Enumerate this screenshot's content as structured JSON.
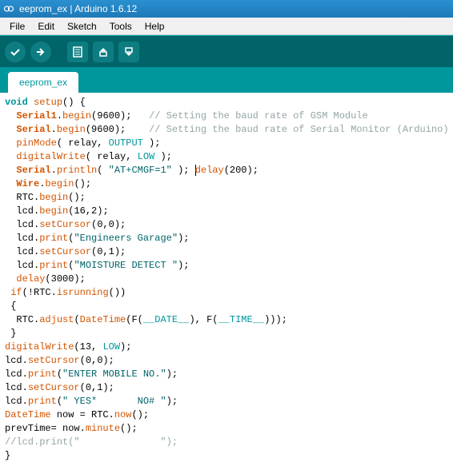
{
  "window": {
    "title": "eeprom_ex | Arduino 1.6.12"
  },
  "menu": {
    "items": [
      "File",
      "Edit",
      "Sketch",
      "Tools",
      "Help"
    ]
  },
  "tab": {
    "label": "eeprom_ex"
  },
  "code": {
    "l1_void": "void",
    "l1_setup": "setup",
    "l1_rest": "() {",
    "l2_obj": "Serial1",
    "l2_dot": ".",
    "l2_fn": "begin",
    "l2_args": "(9600);   ",
    "l2_cmt": "// Setting the baud rate of GSM Module",
    "l3_obj": "Serial",
    "l3_fn": "begin",
    "l3_args": "(9600);    ",
    "l3_cmt": "// Setting the baud rate of Serial Monitor (Arduino)",
    "l4_fn": "pinMode",
    "l4_args": "( relay, ",
    "l4_const": "OUTPUT",
    "l4_end": " );",
    "l5_fn": "digitalWrite",
    "l5_args": "( relay, ",
    "l5_const": "LOW",
    "l5_end": " );",
    "l6_obj": "Serial",
    "l6_fn": "println",
    "l6_open": "( ",
    "l6_str": "\"AT+CMGF=1\"",
    "l6_mid": " ); ",
    "l6_fn2": "delay",
    "l6_end": "(200);",
    "l7_obj": "Wire",
    "l7_fn": "begin",
    "l7_end": "();",
    "l8_obj": "RTC",
    "l8_fn": "begin",
    "l8_end": "();",
    "l9_obj": "lcd",
    "l9_fn": "begin",
    "l9_end": "(16,2);",
    "l10_fn": "setCursor",
    "l10_end": "(0,0);",
    "l11_fn": "print",
    "l11_open": "(",
    "l11_str": "\"Engineers Garage\"",
    "l11_end": ");",
    "l12_fn": "setCursor",
    "l12_end": "(0,1);",
    "l13_fn": "print",
    "l13_open": "(",
    "l13_str": "\"MOISTURE DETECT \"",
    "l13_end": ");",
    "l14_fn": "delay",
    "l14_end": "(3000);",
    "l15_if": "if",
    "l15_open": "(!",
    "l15_obj": "RTC",
    "l15_fn": "isrunning",
    "l15_end": "())",
    "l16": " {",
    "l17_obj": "RTC",
    "l17_fn": "adjust",
    "l17_open": "(",
    "l17_dt": "DateTime",
    "l17_mid": "(F(",
    "l17_date": "__DATE__",
    "l17_mid2": "), F(",
    "l17_time": "__TIME__",
    "l17_end": ")));",
    "l18": " }",
    "l19_fn": "digitalWrite",
    "l19_args": "(13, ",
    "l19_const": "LOW",
    "l19_end": ");",
    "l20_obj": "lcd",
    "l20_fn": "setCursor",
    "l20_end": "(0,0);",
    "l21_fn": "print",
    "l21_open": "(",
    "l21_str": "\"ENTER MOBILE NO.\"",
    "l21_end": ");",
    "l22_fn": "setCursor",
    "l22_end": "(0,1);",
    "l23_fn": "print",
    "l23_open": "(",
    "l23_str": "\" YES*       NO# \"",
    "l23_end": ");",
    "l24_dt": "DateTime",
    "l24_now": " now = ",
    "l24_obj": "RTC",
    "l24_fn": "now",
    "l24_end": "();",
    "l25_pre": "prevTime= now.",
    "l25_fn": "minute",
    "l25_end": "();",
    "l26_cmt": "//lcd.print(\"              \");",
    "l27": "}"
  }
}
